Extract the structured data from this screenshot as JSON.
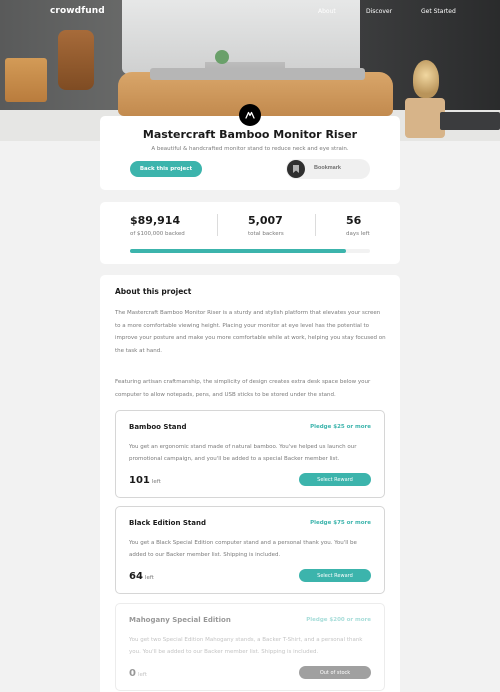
{
  "nav": {
    "logo": "crowdfund",
    "links": [
      "About",
      "Discover",
      "Get Started"
    ]
  },
  "project": {
    "title": "Mastercraft Bamboo Monitor Riser",
    "subtitle": "A beautiful & handcrafted monitor stand to reduce neck and eye strain.",
    "back_label": "Back this project",
    "bookmark_label": "Bookmark"
  },
  "stats": {
    "backed_amount": "$89,914",
    "backed_label": "of $100,000 backed",
    "backers": "5,007",
    "backers_label": "total backers",
    "days": "56",
    "days_label": "days left",
    "progress_fraction": 0.89914
  },
  "about": {
    "heading": "About this project",
    "para1": "The Mastercraft Bamboo Monitor Riser is a sturdy and stylish platform that elevates your screen to a more comfortable viewing height. Placing your monitor at eye level has the potential to improve your posture and make you more comfortable while at work, helping you stay focused on the task at hand.",
    "para2": "Featuring artisan craftmanship, the simplicity of design creates extra desk space below your computer to allow notepads, pens, and USB sticks to be stored under the stand."
  },
  "rewards": [
    {
      "name": "Bamboo Stand",
      "pledge": "Pledge $25 or more",
      "desc": "You get an ergonomic stand made of natural bamboo. You've helped us launch our promotional campaign, and you'll be added to a special Backer member list.",
      "left": "101",
      "left_label": "left",
      "button": "Select Reward"
    },
    {
      "name": "Black Edition Stand",
      "pledge": "Pledge $75 or more",
      "desc": "You get a Black Special Edition computer stand and a personal thank you. You'll be added to our Backer member list. Shipping is included.",
      "left": "64",
      "left_label": "left",
      "button": "Select Reward"
    },
    {
      "name": "Mahogany Special Edition",
      "pledge": "Pledge $200 or more",
      "desc": "You get two Special Edition Mahogany stands, a Backer T-Shirt, and a personal thank you. You'll be added to our Backer member list. Shipping is included.",
      "left": "0",
      "left_label": "left",
      "button": "Out of stock"
    }
  ],
  "colors": {
    "accent": "#3cb4ac",
    "background": "#f2f2f2"
  }
}
